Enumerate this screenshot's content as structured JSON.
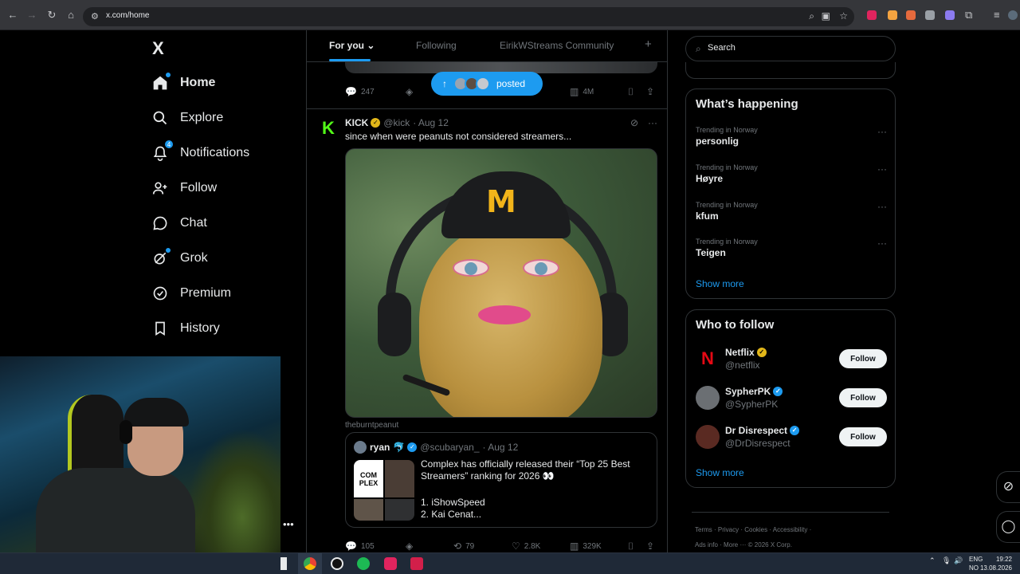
{
  "browser": {
    "url": "x.com/home"
  },
  "sidebar": {
    "logo": "X",
    "items": [
      {
        "label": "Home"
      },
      {
        "label": "Explore"
      },
      {
        "label": "Notifications",
        "badge": "4"
      },
      {
        "label": "Follow"
      },
      {
        "label": "Chat"
      },
      {
        "label": "Grok"
      },
      {
        "label": "Premium"
      },
      {
        "label": "History"
      }
    ]
  },
  "feed": {
    "tabs": [
      "For you",
      "Following",
      "EirikWStreams Community"
    ],
    "posted_pill": "posted",
    "prev_actions": {
      "replies": "247",
      "views": "4M"
    },
    "post": {
      "name": "KICK",
      "handle": "@kick",
      "date": "· Aug 12",
      "text": "since when were peanuts not considered streamers...",
      "media_caption": "theburntpeanut",
      "quote": {
        "name": "ryan",
        "handle": "@scubaryan_",
        "date": "· Aug 12",
        "text": "Complex has officially released their “Top 25 Best Streamers” ranking for 2026 👀",
        "list": [
          "1. iShowSpeed",
          "2. Kai Cenat..."
        ],
        "thumb_label": "COM PLEX"
      },
      "actions": {
        "replies": "105",
        "reposts": "79",
        "likes": "2.8K",
        "views": "329K"
      }
    }
  },
  "right": {
    "search_placeholder": "Search",
    "happening": {
      "title": "What’s happening",
      "trends": [
        {
          "context": "Trending in Norway",
          "topic": "personlig"
        },
        {
          "context": "Trending in Norway",
          "topic": "Høyre"
        },
        {
          "context": "Trending in Norway",
          "topic": "kfum"
        },
        {
          "context": "Trending in Norway",
          "topic": "Teigen"
        }
      ],
      "show_more": "Show more"
    },
    "who_to_follow": {
      "title": "Who to follow",
      "accounts": [
        {
          "name": "Netflix",
          "handle": "@netflix",
          "badge_color": "#e2b719"
        },
        {
          "name": "SypherPK",
          "handle": "@SypherPK",
          "badge_color": "#1d9bf0"
        },
        {
          "name": "Dr Disrespect",
          "handle": "@DrDisrespect",
          "badge_color": "#1d9bf0"
        }
      ],
      "follow_label": "Follow",
      "show_more": "Show more"
    },
    "footer": {
      "line1": "Terms · Privacy · Cookies · Accessibility ·",
      "line2": "Ads info · More ··· © 2026 X Corp."
    }
  },
  "taskbar": {
    "lang1": "ENG",
    "lang2": "NO",
    "time": "19:22",
    "date": "13.08.2026"
  }
}
